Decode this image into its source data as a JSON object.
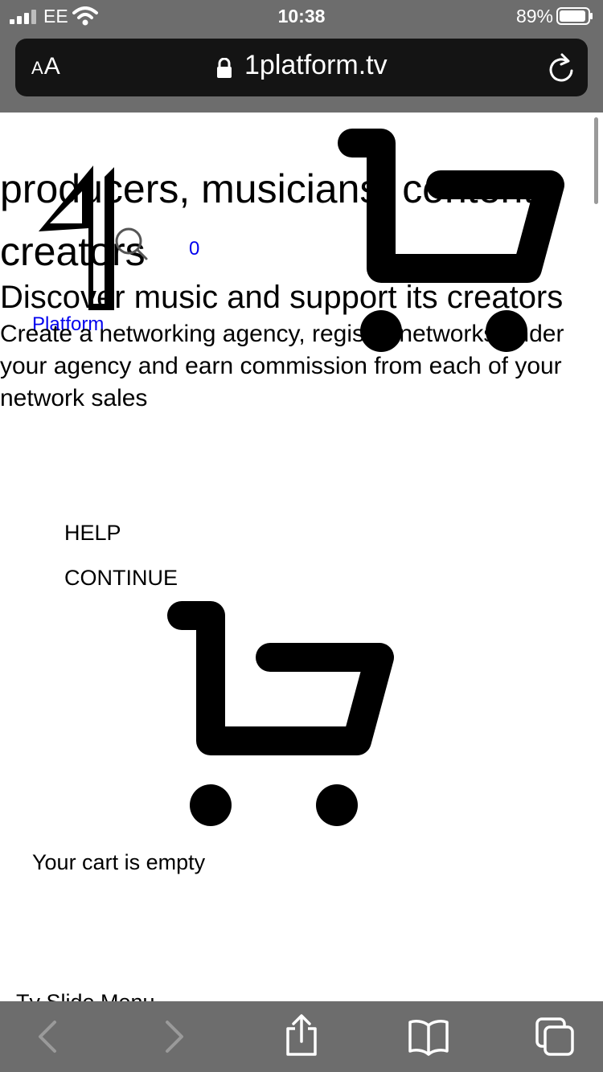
{
  "status": {
    "carrier": "EE",
    "time": "10:38",
    "battery": "89%"
  },
  "address_bar": {
    "text_size_small": "A",
    "text_size_large": "A",
    "url": "1platform.tv"
  },
  "page": {
    "hero_line1": "producers, musicians, content",
    "hero_line2": "creators",
    "cart_count": "0",
    "logo_caption": "Platform",
    "sub_heading": "Discover music and support its creators",
    "description": "Create a networking agency, register networks under your agency and earn commission from each of your network sales",
    "help": "HELP",
    "continue": "CONTINUE",
    "empty_cart": "Your cart is empty",
    "slide_menu": "Tv Slide Menu"
  },
  "icons": {
    "back": "chevron-left-icon",
    "forward": "chevron-right-icon",
    "share": "share-icon",
    "bookmarks": "book-icon",
    "tabs": "tabs-icon"
  }
}
